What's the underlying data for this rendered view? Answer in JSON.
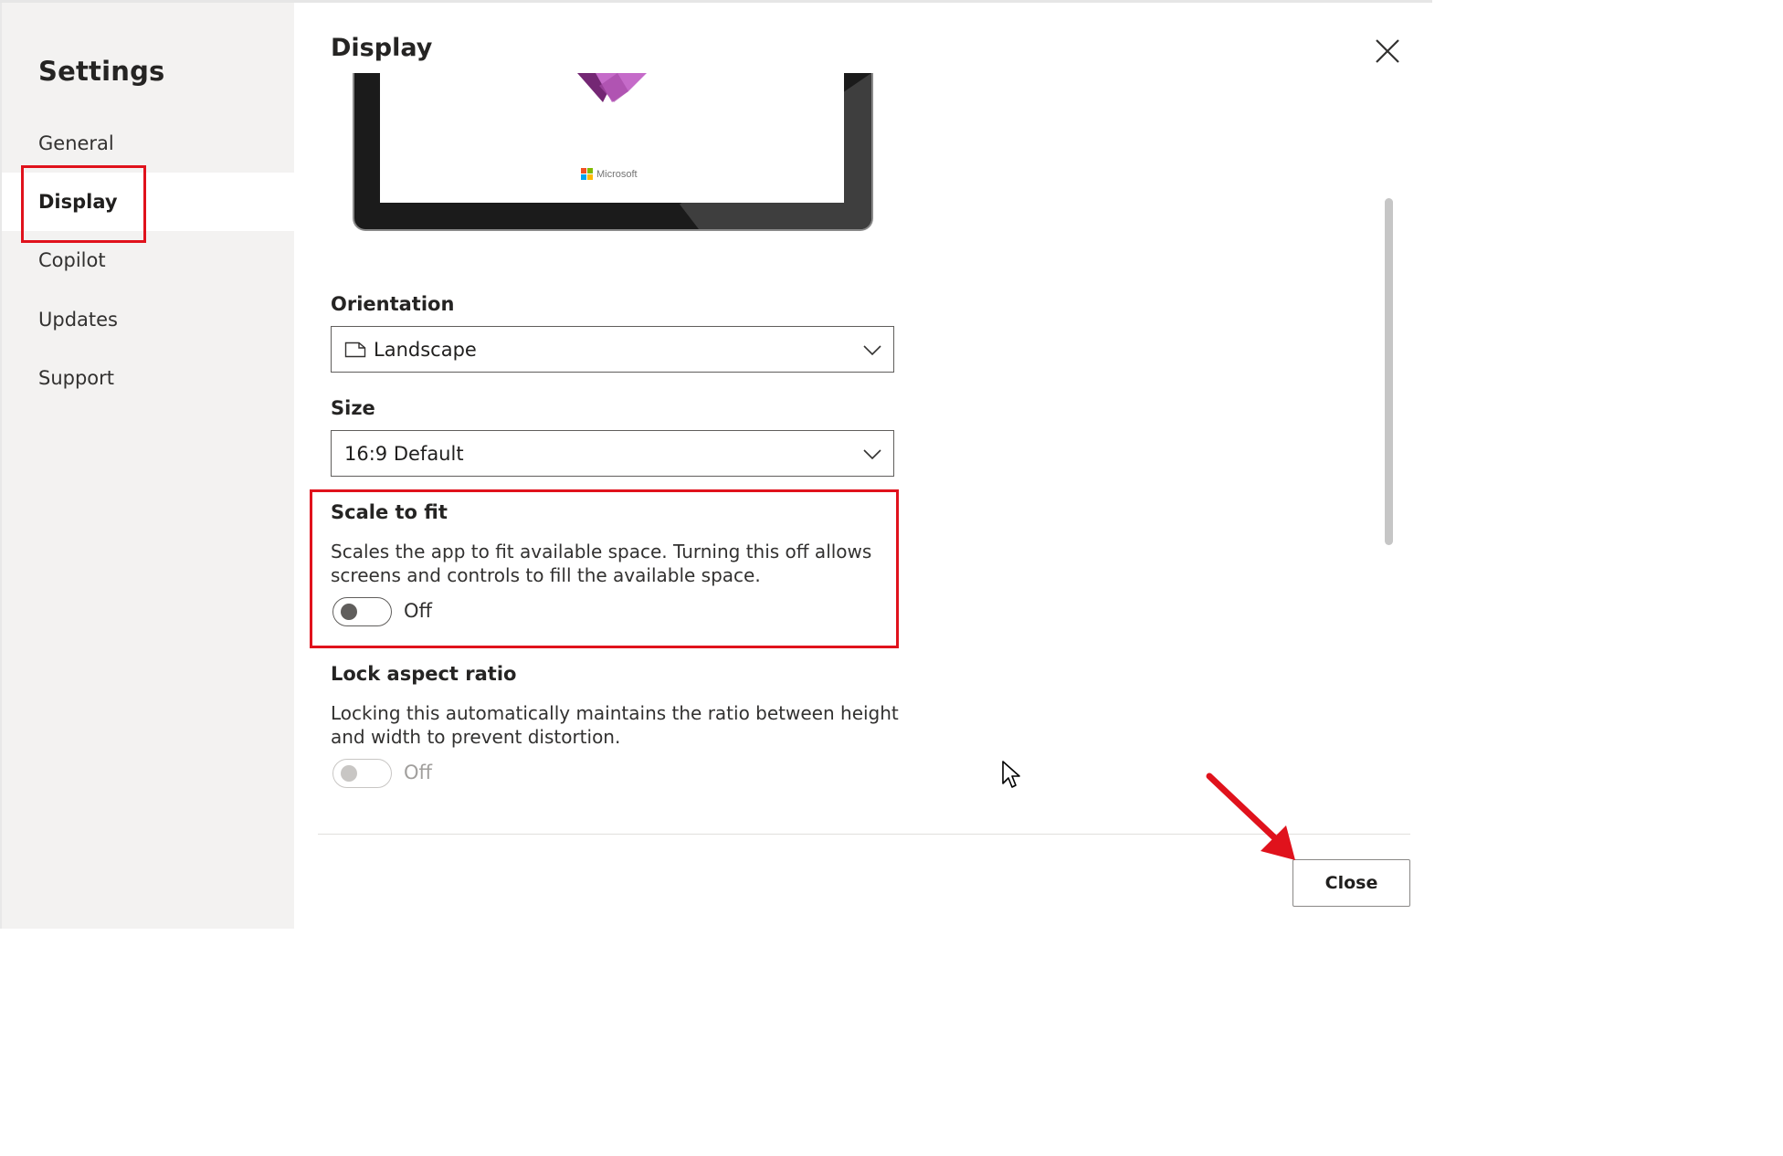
{
  "sidebar": {
    "title": "Settings",
    "items": [
      {
        "label": "General",
        "active": false
      },
      {
        "label": "Display",
        "active": true
      },
      {
        "label": "Copilot",
        "active": false
      },
      {
        "label": "Updates",
        "active": false
      },
      {
        "label": "Support",
        "active": false
      }
    ]
  },
  "main": {
    "title": "Display",
    "preview": {
      "brand_text": "Microsoft"
    },
    "orientation": {
      "label": "Orientation",
      "value": "Landscape",
      "icon": "page-landscape-icon"
    },
    "size": {
      "label": "Size",
      "value": "16:9 Default"
    },
    "scale_to_fit": {
      "label": "Scale to fit",
      "description": "Scales the app to fit available space. Turning this off allows screens and controls to fill the available space.",
      "state": "Off"
    },
    "lock_aspect_ratio": {
      "label": "Lock aspect ratio",
      "description": "Locking this automatically maintains the ratio between height and width to prevent distortion.",
      "state": "Off",
      "disabled": true
    },
    "close_label": "Close"
  },
  "colors": {
    "highlight": "#e0121c",
    "accent_purple": "#7a2a8c",
    "sidebar_bg": "#f3f2f1"
  }
}
